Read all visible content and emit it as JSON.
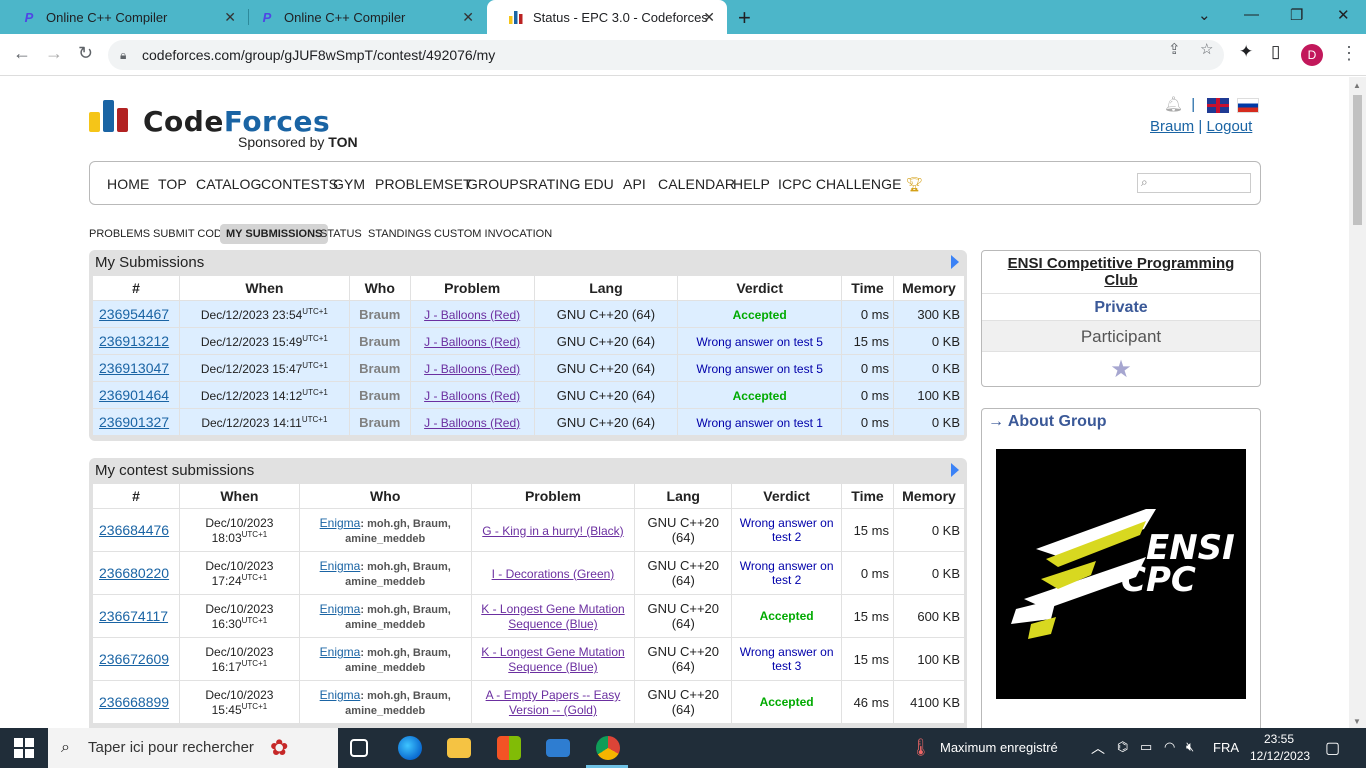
{
  "browser": {
    "tabs": [
      {
        "title": "Online C++ Compiler",
        "favicon": "P",
        "active": false
      },
      {
        "title": "Online C++ Compiler",
        "favicon": "P",
        "active": false
      },
      {
        "title": "Status - EPC 3.0 - Codeforces",
        "favicon": "codeforces-icon",
        "active": true
      }
    ],
    "url": "codeforces.com/group/gJUF8wSmpT/contest/492076/my",
    "profile_initial": "D"
  },
  "header": {
    "logo_word_a": "Code",
    "logo_word_b": "Forces",
    "sponsor_prefix": "Sponsored by",
    "sponsor_name": "TON",
    "user": "Braum",
    "logout": "Logout"
  },
  "menu": [
    "HOME",
    "TOP",
    "CATALOG",
    "CONTESTS",
    "GYM",
    "PROBLEMSET",
    "GROUPS",
    "RATING",
    "EDU",
    "API",
    "CALENDAR",
    "HELP",
    "ICPC CHALLENGE"
  ],
  "subnav": [
    "PROBLEMS",
    "SUBMIT CODE",
    "MY SUBMISSIONS",
    "STATUS",
    "STANDINGS",
    "CUSTOM INVOCATION"
  ],
  "my_submissions": {
    "caption": "My Submissions",
    "headers": [
      "#",
      "When",
      "Who",
      "Problem",
      "Lang",
      "Verdict",
      "Time",
      "Memory"
    ],
    "rows": [
      {
        "id": "236954467",
        "when": "Dec/12/2023 23:54",
        "tz": "UTC+1",
        "who": "Braum",
        "problem": "J - Balloons (Red)",
        "lang": "GNU C++20 (64)",
        "verdict": "Accepted",
        "time": "0 ms",
        "memory": "300 KB"
      },
      {
        "id": "236913212",
        "when": "Dec/12/2023 15:49",
        "tz": "UTC+1",
        "who": "Braum",
        "problem": "J - Balloons (Red)",
        "lang": "GNU C++20 (64)",
        "verdict": "Wrong answer on test 5",
        "time": "15 ms",
        "memory": "0 KB"
      },
      {
        "id": "236913047",
        "when": "Dec/12/2023 15:47",
        "tz": "UTC+1",
        "who": "Braum",
        "problem": "J - Balloons (Red)",
        "lang": "GNU C++20 (64)",
        "verdict": "Wrong answer on test 5",
        "time": "0 ms",
        "memory": "0 KB"
      },
      {
        "id": "236901464",
        "when": "Dec/12/2023 14:12",
        "tz": "UTC+1",
        "who": "Braum",
        "problem": "J - Balloons (Red)",
        "lang": "GNU C++20 (64)",
        "verdict": "Accepted",
        "time": "0 ms",
        "memory": "100 KB"
      },
      {
        "id": "236901327",
        "when": "Dec/12/2023 14:11",
        "tz": "UTC+1",
        "who": "Braum",
        "problem": "J - Balloons (Red)",
        "lang": "GNU C++20 (64)",
        "verdict": "Wrong answer on test 1",
        "time": "0 ms",
        "memory": "0 KB"
      }
    ]
  },
  "contest_submissions": {
    "caption": "My contest submissions",
    "headers": [
      "#",
      "When",
      "Who",
      "Problem",
      "Lang",
      "Verdict",
      "Time",
      "Memory"
    ],
    "rows": [
      {
        "id": "236684476",
        "date": "Dec/10/2023",
        "clock": "18:03",
        "tz": "UTC+1",
        "team": "Enigma",
        "members_line1": "moh.gh, Braum,",
        "members_line2": "amine_meddeb",
        "problem_l1": "G - King in a hurry! (Black)",
        "problem_l2": "",
        "lang_l1": "GNU C++20",
        "lang_l2": "(64)",
        "verdict_l1": "Wrong answer on",
        "verdict_l2": "test 2",
        "accepted": false,
        "time": "15 ms",
        "memory": "0 KB"
      },
      {
        "id": "236680220",
        "date": "Dec/10/2023",
        "clock": "17:24",
        "tz": "UTC+1",
        "team": "Enigma",
        "members_line1": "moh.gh, Braum,",
        "members_line2": "amine_meddeb",
        "problem_l1": "I - Decorations (Green)",
        "problem_l2": "",
        "lang_l1": "GNU C++20",
        "lang_l2": "(64)",
        "verdict_l1": "Wrong answer on",
        "verdict_l2": "test 2",
        "accepted": false,
        "time": "0 ms",
        "memory": "0 KB"
      },
      {
        "id": "236674117",
        "date": "Dec/10/2023",
        "clock": "16:30",
        "tz": "UTC+1",
        "team": "Enigma",
        "members_line1": "moh.gh, Braum,",
        "members_line2": "amine_meddeb",
        "problem_l1": "K - Longest Gene Mutation",
        "problem_l2": "Sequence (Blue)",
        "lang_l1": "GNU C++20",
        "lang_l2": "(64)",
        "verdict_l1": "Accepted",
        "verdict_l2": "",
        "accepted": true,
        "time": "15 ms",
        "memory": "600 KB"
      },
      {
        "id": "236672609",
        "date": "Dec/10/2023",
        "clock": "16:17",
        "tz": "UTC+1",
        "team": "Enigma",
        "members_line1": "moh.gh, Braum,",
        "members_line2": "amine_meddeb",
        "problem_l1": "K - Longest Gene Mutation",
        "problem_l2": "Sequence (Blue)",
        "lang_l1": "GNU C++20",
        "lang_l2": "(64)",
        "verdict_l1": "Wrong answer on",
        "verdict_l2": "test 3",
        "accepted": false,
        "time": "15 ms",
        "memory": "100 KB"
      },
      {
        "id": "236668899",
        "date": "Dec/10/2023",
        "clock": "15:45",
        "tz": "UTC+1",
        "team": "Enigma",
        "members_line1": "moh.gh, Braum,",
        "members_line2": "amine_meddeb",
        "problem_l1": "A - Empty Papers -- Easy",
        "problem_l2": "Version -- (Gold)",
        "lang_l1": "GNU C++20",
        "lang_l2": "(64)",
        "verdict_l1": "Accepted",
        "verdict_l2": "",
        "accepted": true,
        "time": "46 ms",
        "memory": "4100 KB"
      }
    ]
  },
  "sidebar": {
    "group_title": "ENSI Competitive Programming Club",
    "private": "Private",
    "role": "Participant",
    "about_title": "→ About Group",
    "logo_line1": "ENSI",
    "logo_line2": "CPC"
  },
  "taskbar": {
    "search_placeholder": "Taper ici pour rechercher",
    "weather": "Maximum enregistré",
    "lang": "FRA",
    "time": "23:55",
    "date": "12/12/2023"
  },
  "colors": {
    "accent_blue": "#1a64a4",
    "accepted_green": "#00aa00",
    "wrong_blue": "#0000aa",
    "tabbar": "#4cb6c9",
    "highlight_row": "#ddeeff"
  }
}
